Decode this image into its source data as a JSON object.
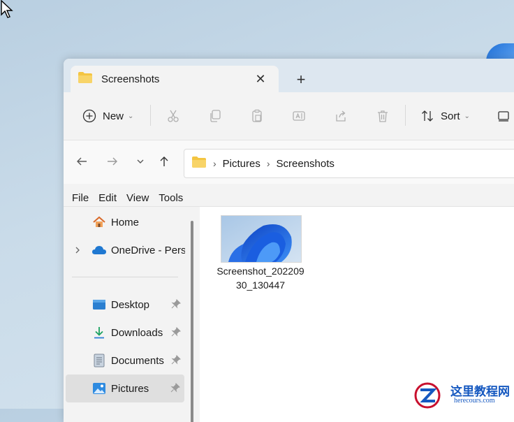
{
  "tab": {
    "title": "Screenshots"
  },
  "toolbar": {
    "new_label": "New",
    "sort_label": "Sort"
  },
  "address": {
    "crumbs": [
      "Pictures",
      "Screenshots"
    ]
  },
  "menu": [
    "File",
    "Edit",
    "View",
    "Tools"
  ],
  "sidebar": {
    "items": [
      {
        "label": "Home"
      },
      {
        "label": "OneDrive - Pers"
      },
      {
        "label": "Desktop"
      },
      {
        "label": "Downloads"
      },
      {
        "label": "Documents"
      },
      {
        "label": "Pictures"
      }
    ]
  },
  "file": {
    "name": "Screenshot_20220930_130447"
  },
  "watermark": {
    "title": "这里教程网",
    "site": "herecours.com"
  },
  "colors": {
    "accent": "#1f6fd6",
    "folder": "#f4c542"
  }
}
